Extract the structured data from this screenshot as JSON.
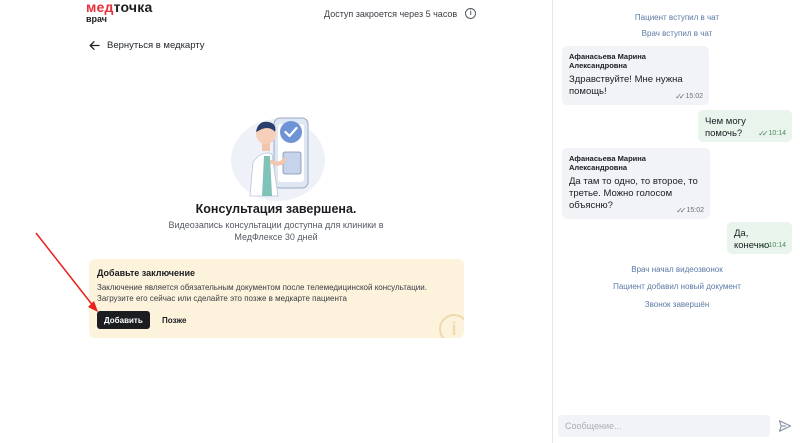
{
  "header": {
    "logo_part1": "мед",
    "logo_part2": "точка",
    "logo_sub": "врач",
    "access_text": "Доступ закроется через 5 часов",
    "info_icon": "info-icon"
  },
  "back": {
    "label": "Вернуться в медкарту",
    "icon": "arrow-left-icon"
  },
  "status": {
    "title": "Консультация завершена.",
    "text": "Видеозапись консультации доступна для клиники в МедФлексе 30 дней"
  },
  "conclusion_card": {
    "title": "Добавьте заключение",
    "text": "Заключение является обязательным документом после телемедицинской консультации. Загрузите его сейчас или сделайте это позже в медкарте пациента",
    "add_label": "Добавить",
    "later_label": "Позже"
  },
  "chat": {
    "events_top": [
      "Пациент вступил в чат",
      "Врач вступил в чат"
    ],
    "messages": [
      {
        "from": "patient",
        "author": "Афанасьева Марина Александровна",
        "text": "Здравствуйте! Мне нужна помощь!",
        "time": "15:02"
      },
      {
        "from": "doctor",
        "text": "Чем могу помочь?",
        "time": "10:14"
      },
      {
        "from": "patient",
        "author": "Афанасьева Марина Александровна",
        "text": "Да там то одно, то второе, то третье. Можно голосом объясню?",
        "time": "15:02"
      },
      {
        "from": "doctor",
        "text": "Да, конечно",
        "time": "10:14"
      }
    ],
    "events_bottom": [
      "Врач начал видеозвонок",
      "Пациент добавил новый документ",
      "Звонок завершён"
    ],
    "composer_placeholder": "Сообщение...",
    "send_icon": "send-icon"
  },
  "colors": {
    "brand_red": "#e7303a",
    "card_bg": "#fdf2dc",
    "doctor_bubble": "#e8f4ec",
    "patient_bubble": "#f1f3f6",
    "annotation_arrow": "#e8211b"
  }
}
